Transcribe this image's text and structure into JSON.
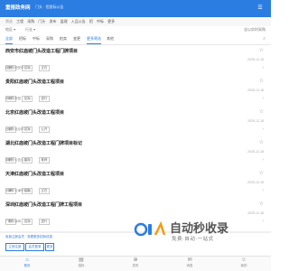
{
  "header": {
    "logo": "重报政务网",
    "slogan": "门头 · 招投标公告"
  },
  "categories": {
    "label": "筛选",
    "items": [
      "工程",
      "采购",
      "门头",
      "发布",
      "监理",
      "入品公告",
      "招",
      "中标",
      "更多"
    ]
  },
  "filters": {
    "region": "地区",
    "industry": "行业",
    "tagline": "全以实时采购"
  },
  "tabs": [
    "全部",
    "招标",
    "中标",
    "采购",
    "拍卖",
    "变更",
    "更多筛选",
    "其他"
  ],
  "listings": [
    {
      "title": "西安市红庙坡门头改造工程门牌项目",
      "tags": [
        "采购",
        "招标",
        "正在"
      ],
      "time": "2025-12-18",
      "meta": "陕西 · 西安市"
    },
    {
      "title": "贵阳红庙坡门头改造工程项目",
      "tags": [
        "采购",
        "招标",
        "进行"
      ],
      "time": "2025-12-18",
      "meta": "贵州 · 贵阳"
    },
    {
      "title": "北京红庙坡门头改造工程项目",
      "tags": [
        "采购",
        "招标",
        "公开"
      ],
      "time": "2025-12-18",
      "meta": "北京 · 北京市"
    },
    {
      "title": "湖北红庙坡门头改造工程门牌项目标记",
      "tags": [
        "采购",
        "招标",
        "推荐"
      ],
      "time": "2025-12-18",
      "meta": "湖北 · 公告公示"
    },
    {
      "title": "天津红庙坡门头改造工程项目",
      "tags": [
        "采购",
        "招标",
        "正在"
      ],
      "time": "2025-12-18",
      "meta": "天津 · 天津市公示"
    },
    {
      "title": "深圳红庙坡门头改造工程门牌工程项目",
      "tags": [
        "采购",
        "招标",
        "进行"
      ],
      "time": "2025-12-18",
      "meta": "广东 · 深圳"
    }
  ],
  "register": {
    "promo": "免费注册会员 · 查看更多招标信息",
    "buttons": [
      "立即注册",
      "会员登录",
      "更多"
    ]
  },
  "nav": [
    {
      "label": "首页",
      "icon": "home-icon"
    },
    {
      "label": "招标",
      "icon": "doc-icon"
    },
    {
      "label": "发布",
      "icon": "plus-icon"
    },
    {
      "label": "消息",
      "icon": "bell-icon"
    },
    {
      "label": "我的",
      "icon": "user-icon"
    }
  ],
  "watermark": {
    "title": "自动秒收录",
    "subtitle": "免费·自动·一站式"
  },
  "colors": {
    "primary": "#2b7de1",
    "text": "#333333",
    "muted": "#888888"
  }
}
